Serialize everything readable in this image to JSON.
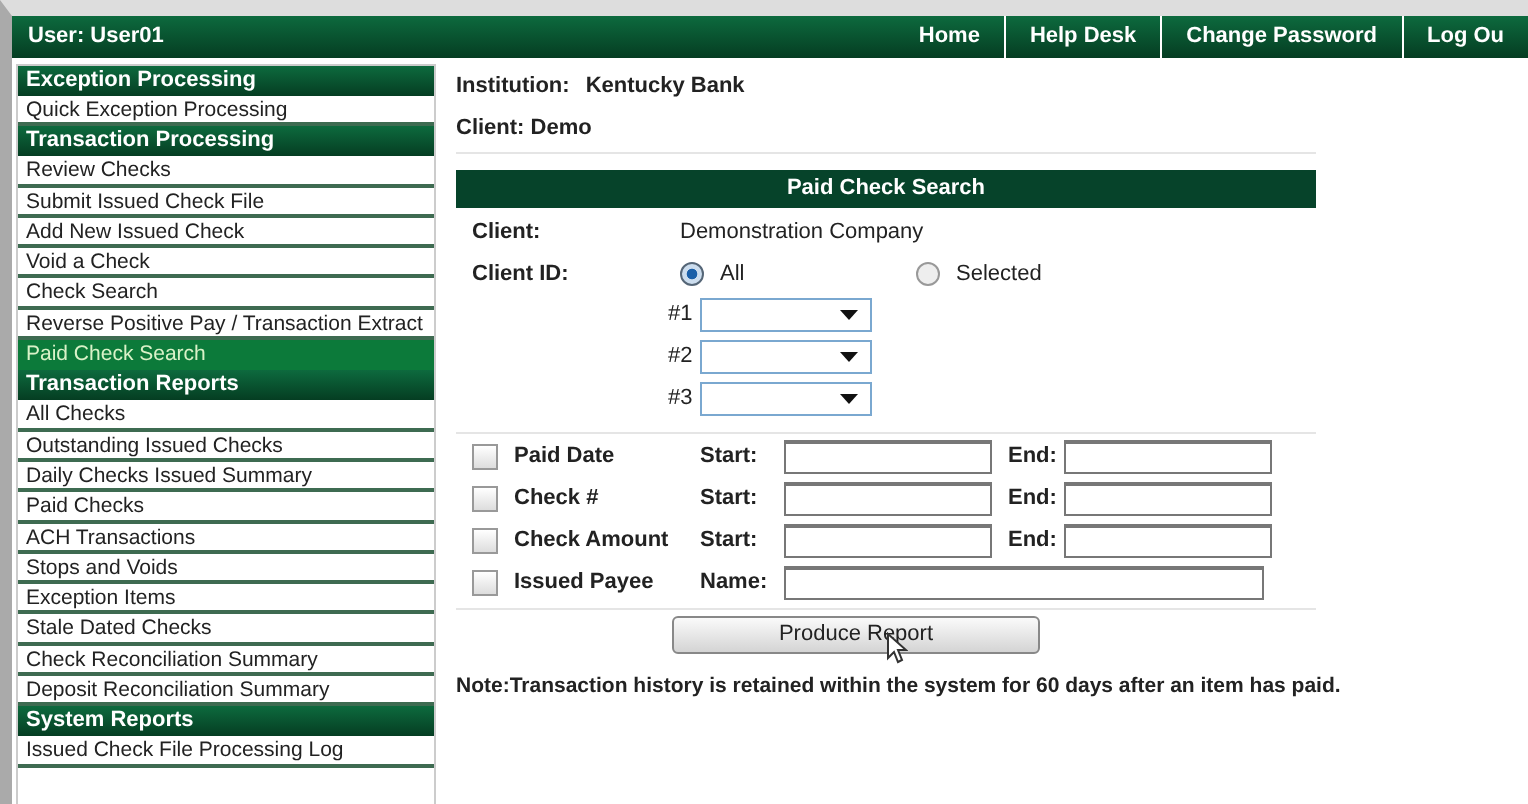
{
  "top_bar": {
    "user": "User: User01",
    "links": [
      "Home",
      "Help Desk",
      "Change Password",
      "Log Ou"
    ]
  },
  "sidebar": {
    "sections": [
      {
        "title": "Exception Processing",
        "items": [
          {
            "label": "Quick Exception Processing",
            "selected": false
          }
        ]
      },
      {
        "title": "Transaction Processing",
        "items": [
          {
            "label": "Review Checks",
            "selected": false
          },
          {
            "label": "Submit Issued Check File",
            "selected": false
          },
          {
            "label": "Add New Issued Check",
            "selected": false
          },
          {
            "label": "Void a Check",
            "selected": false
          },
          {
            "label": "Check Search",
            "selected": false
          },
          {
            "label": "Reverse Positive Pay / Transaction Extract",
            "selected": false
          },
          {
            "label": "Paid Check Search",
            "selected": true
          }
        ]
      },
      {
        "title": "Transaction Reports",
        "items": [
          {
            "label": "All Checks",
            "selected": false
          },
          {
            "label": "Outstanding Issued Checks",
            "selected": false
          },
          {
            "label": "Daily Checks Issued Summary",
            "selected": false
          },
          {
            "label": "Paid Checks",
            "selected": false
          },
          {
            "label": "ACH Transactions",
            "selected": false
          },
          {
            "label": "Stops and Voids",
            "selected": false
          },
          {
            "label": "Exception Items",
            "selected": false
          },
          {
            "label": "Stale Dated Checks",
            "selected": false
          },
          {
            "label": "Check Reconciliation Summary",
            "selected": false
          },
          {
            "label": "Deposit Reconciliation Summary",
            "selected": false
          }
        ]
      },
      {
        "title": "System Reports",
        "items": [
          {
            "label": "Issued Check File Processing Log",
            "selected": false
          }
        ]
      }
    ]
  },
  "header": {
    "institution_label": "Institution:",
    "institution": "Kentucky Bank",
    "client": "Client: Demo"
  },
  "panel": {
    "title": "Paid Check Search",
    "client_label": "Client:",
    "client_value": "Demonstration Company",
    "client_id_label": "Client ID:",
    "client_id_options": [
      {
        "label": "All",
        "selected": true
      },
      {
        "label": "Selected",
        "selected": false
      }
    ],
    "dropdowns": [
      {
        "label": "#1"
      },
      {
        "label": "#2"
      },
      {
        "label": "#3"
      }
    ],
    "criteria": [
      {
        "kind": "range",
        "label": "Paid Date",
        "checked": false,
        "start_label": "Start:",
        "end_label": "End:"
      },
      {
        "kind": "range",
        "label": "Check #",
        "checked": false,
        "start_label": "Start:",
        "end_label": "End:"
      },
      {
        "kind": "range",
        "label": "Check Amount",
        "checked": false,
        "start_label": "Start:",
        "end_label": "End:"
      },
      {
        "kind": "name",
        "label": "Issued Payee",
        "checked": false,
        "name_label": "Name:"
      }
    ],
    "button": "Produce Report",
    "note": "Note:Transaction history is retained within the system for 60 days after an item has paid."
  }
}
